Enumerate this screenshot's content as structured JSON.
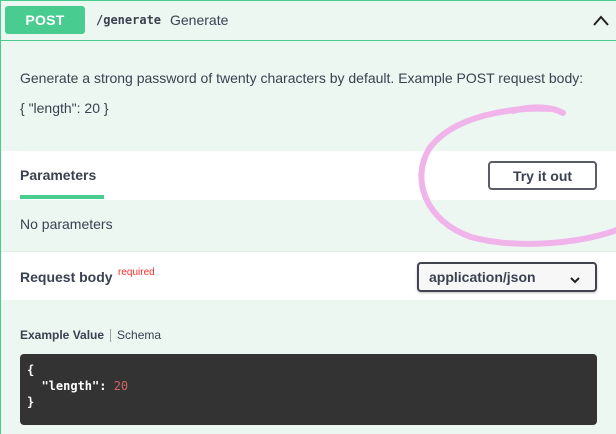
{
  "summary": {
    "method": "POST",
    "path": "/generate",
    "title": "Generate"
  },
  "description": {
    "text": "Generate a strong password of twenty characters by default. Example POST request body:",
    "body_example": "{ \"length\": 20 }"
  },
  "parameters": {
    "tab_label": "Parameters",
    "try_button_label": "Try it out",
    "empty_text": "No parameters"
  },
  "request_body": {
    "title": "Request body",
    "required_label": "required",
    "content_type": "application/json"
  },
  "example": {
    "active_tab": "Example Value",
    "other_tab": "Schema",
    "code_open": "{",
    "code_key": "  \"length\": ",
    "code_value": "20",
    "code_close": "}"
  },
  "colors": {
    "post_green": "#49cc90",
    "block_bg": "#ebf7f0",
    "annotation": "#f0b4ea",
    "code_bg": "#333333"
  },
  "icons": {
    "collapse": "chevron-up-icon",
    "select": "chevron-down-icon"
  }
}
